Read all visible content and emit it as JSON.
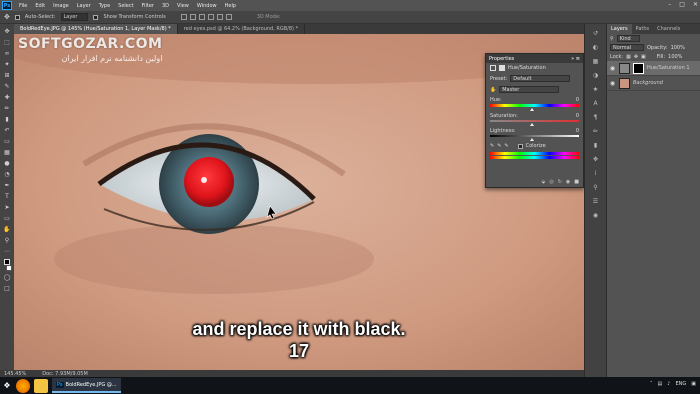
{
  "menubar": {
    "app_icon": "Ps",
    "items": [
      "File",
      "Edit",
      "Image",
      "Layer",
      "Type",
      "Select",
      "Filter",
      "3D",
      "View",
      "Window",
      "Help"
    ],
    "window_controls": [
      "minimize-icon",
      "maximize-icon",
      "close-icon"
    ]
  },
  "options": {
    "auto_select_label": "Auto-Select:",
    "auto_select_value": "Layer",
    "show_transform_label": "Show Transform Controls",
    "mode_label": "3D Mode:"
  },
  "tabs": [
    {
      "label": "BoldRedEye.JPG @ 145% (Hue/Saturation 1, Layer Mask/8) *",
      "active": true
    },
    {
      "label": "red eyes.psd @ 64.2% (Background, RGB/8) *",
      "active": false
    }
  ],
  "watermark": {
    "line1": "SOFTGOZAR.COM",
    "line2": "اولین دانشنامه نرم افزار ایران"
  },
  "properties": {
    "title": "Properties",
    "layer_type": "Hue/Saturation",
    "preset_label": "Preset:",
    "preset_value": "Default",
    "channel_value": "Master",
    "hue_label": "Hue:",
    "hue_value": "0",
    "saturation_label": "Saturation:",
    "saturation_value": "0",
    "lightness_label": "Lightness:",
    "lightness_value": "0",
    "colorize_label": "Colorize"
  },
  "layers_panel": {
    "tabs": [
      "Layers",
      "Paths",
      "Channels"
    ],
    "filter_kind": "Kind",
    "blend_mode": "Normal",
    "opacity_label": "Opacity:",
    "opacity_value": "100%",
    "lock_label": "Lock:",
    "fill_label": "Fill:",
    "fill_value": "100%",
    "layers": [
      {
        "name": "Hue/Saturation 1",
        "active": true
      },
      {
        "name": "Background",
        "active": false
      }
    ]
  },
  "status": {
    "zoom": "145.45%",
    "doc": "Doc: 7.93M/9.05M"
  },
  "caption": {
    "line1": "and replace it with black.",
    "line2": "17"
  },
  "taskbar": {
    "app_label": "BoldRedEye.JPG @...",
    "tray_lang": "ENG"
  },
  "colors": {
    "red_eye": "#e0141c",
    "iris": "#4c6f7d",
    "skin": "#d9a58a",
    "ps_blue": "#31a8ff"
  }
}
